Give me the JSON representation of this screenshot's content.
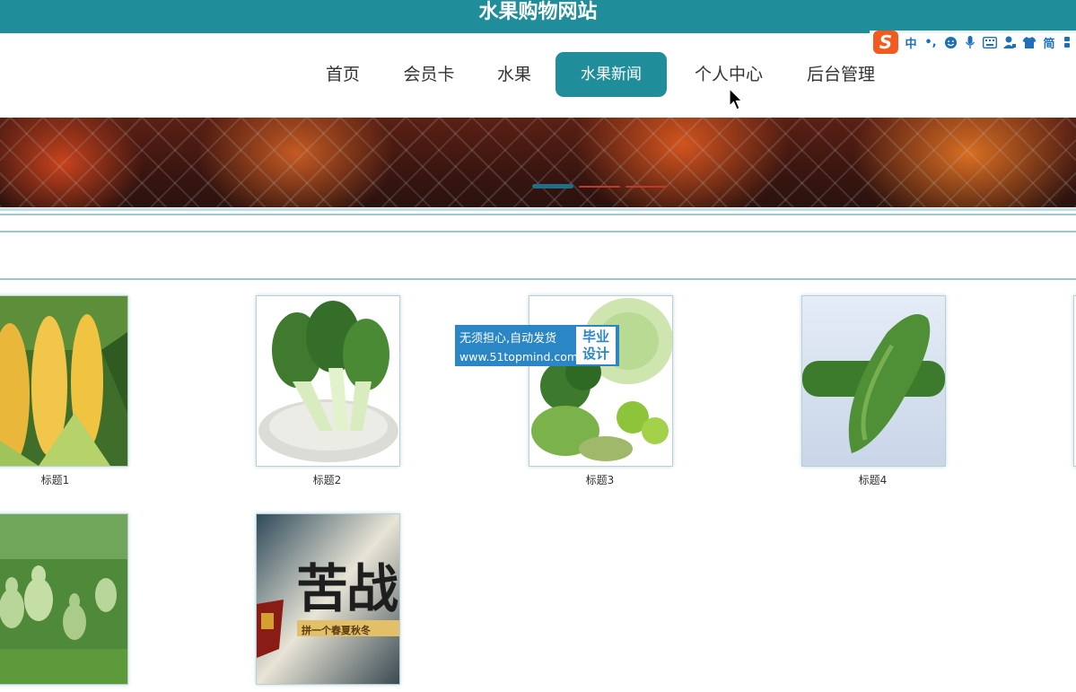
{
  "site": {
    "title": "水果购物网站"
  },
  "nav": {
    "items": [
      {
        "label": "首页",
        "active": false
      },
      {
        "label": "会员卡",
        "active": false
      },
      {
        "label": "水果",
        "active": false
      },
      {
        "label": "水果新闻",
        "active": true
      },
      {
        "label": "个人中心",
        "active": false
      },
      {
        "label": "后台管理",
        "active": false
      }
    ]
  },
  "ime_toolbar": {
    "logo": "S",
    "mode": "中",
    "punct": "•,",
    "script": "简",
    "icons": [
      "emoji-icon",
      "microphone-icon",
      "keyboard-icon",
      "user-icon",
      "shirt-icon",
      "settings-icon"
    ]
  },
  "banner": {
    "slides": 3,
    "active_slide": 1,
    "accent": "#1f8e9a"
  },
  "products": [
    {
      "label": "标题1",
      "image": "corn"
    },
    {
      "label": "标题2",
      "image": "bok-choy"
    },
    {
      "label": "标题3",
      "image": "mixed-vegetables"
    },
    {
      "label": "标题4",
      "image": "cucumber"
    },
    {
      "label": "",
      "image": "gourds"
    },
    {
      "label": "",
      "image": "promo-poster"
    }
  ],
  "poster": {
    "headline": "苦战",
    "subline": "拼一个春夏秋冬"
  },
  "watermark": {
    "line1": "无须担心,自动发货",
    "line2": "www.51topmind.com",
    "badge1": "毕业",
    "badge2": "设计"
  },
  "colors": {
    "primary": "#1f8e9a",
    "watermark": "#2b86c5"
  }
}
